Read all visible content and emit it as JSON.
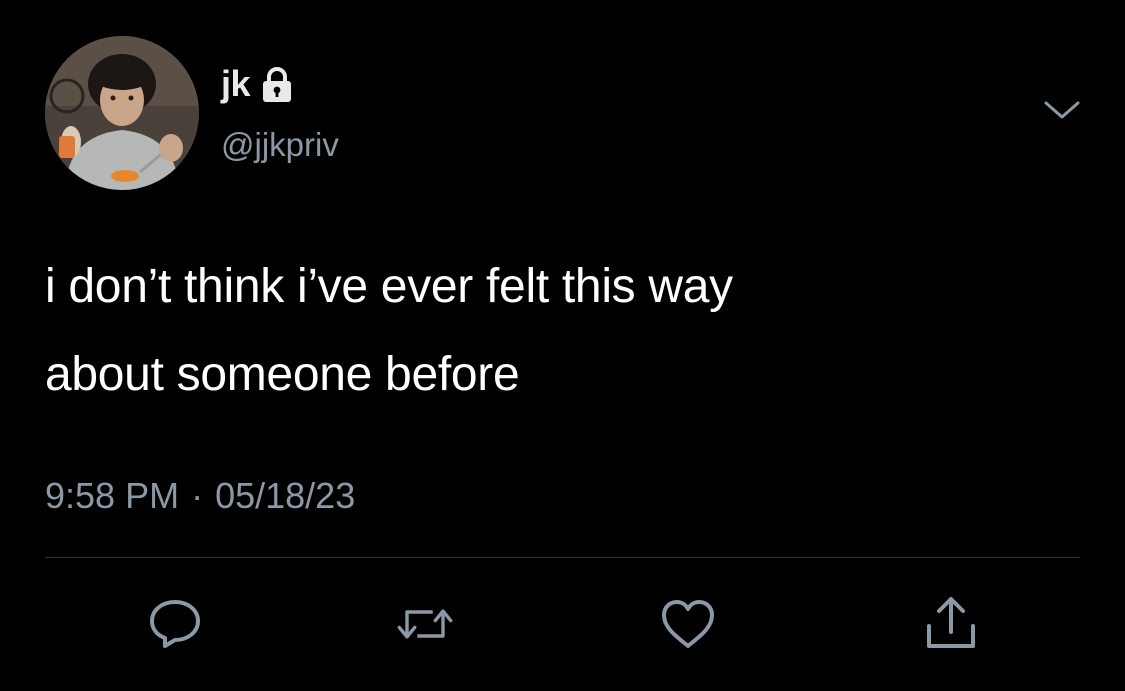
{
  "author": {
    "display_name": "jk",
    "handle": "@jjkpriv",
    "protected": true,
    "lock_icon": "lock-icon"
  },
  "tweet": {
    "text_lines": [
      "i don’t think i’ve ever felt this way",
      "about someone before"
    ],
    "time": "9:58 PM",
    "separator": "·",
    "date": "05/18/23"
  },
  "actions": [
    {
      "name": "reply",
      "icon": "speech-bubble-icon"
    },
    {
      "name": "retweet",
      "icon": "retweet-arrows-icon"
    },
    {
      "name": "like",
      "icon": "heart-icon"
    },
    {
      "name": "share",
      "icon": "share-upload-icon"
    }
  ],
  "colors": {
    "background": "#000000",
    "primary_text": "#ffffff",
    "name_text": "#e7e9ea",
    "secondary_text": "#8b98a5",
    "divider": "#2f3336",
    "icon": "#8b98a5"
  }
}
